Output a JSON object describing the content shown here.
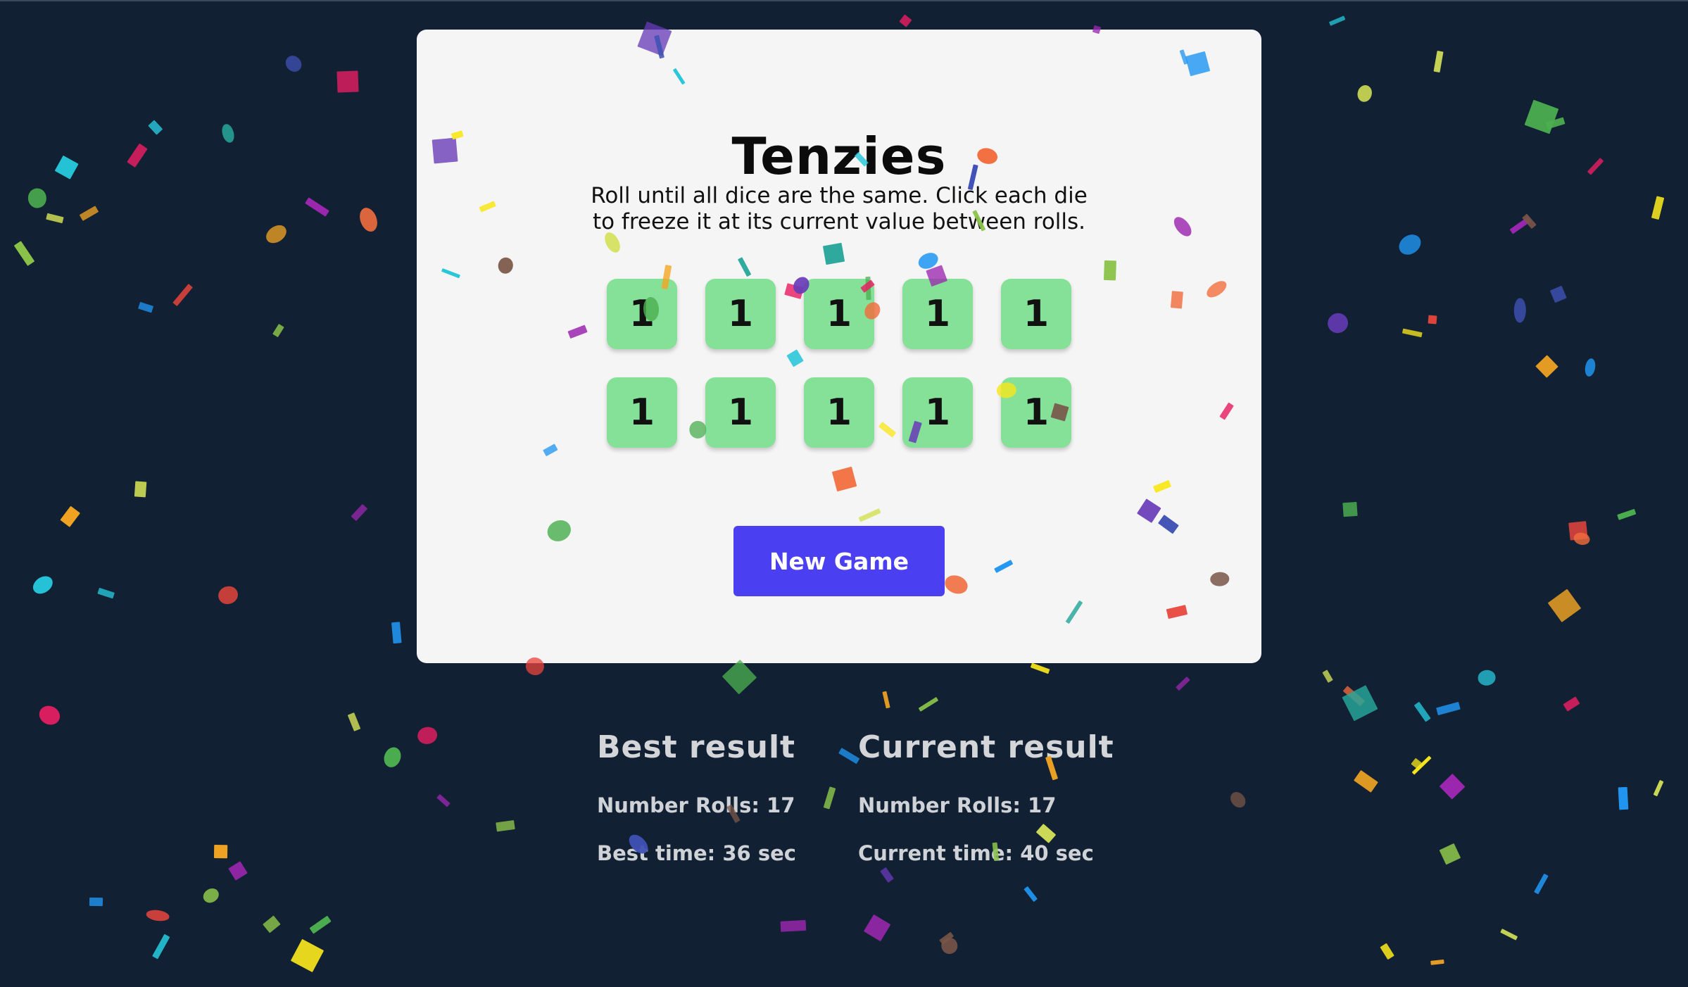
{
  "app": {
    "title": "Tenzies",
    "instructions": "Roll until all dice are the same. Click each die to freeze it at its current value between rolls."
  },
  "dice": [
    {
      "value": "1"
    },
    {
      "value": "1"
    },
    {
      "value": "1"
    },
    {
      "value": "1"
    },
    {
      "value": "1"
    },
    {
      "value": "1"
    },
    {
      "value": "1"
    },
    {
      "value": "1"
    },
    {
      "value": "1"
    },
    {
      "value": "1"
    }
  ],
  "controls": {
    "new_game_label": "New Game"
  },
  "best": {
    "heading": "Best result",
    "rolls": "Number Rolls: 17",
    "time": "Best time: 36 sec"
  },
  "current": {
    "heading": "Current result",
    "rolls": "Number Rolls: 17",
    "time": "Current time: 40 sec"
  },
  "colors": {
    "background": "#112032",
    "card": "#f5f5f5",
    "die": "#84e197",
    "button": "#4a40f2",
    "results_text": "#d3d5d8"
  },
  "confetti_colors": [
    "#e8453c",
    "#f26d3d",
    "#f5a623",
    "#f8e71c",
    "#d4e157",
    "#8bc34a",
    "#4caf50",
    "#26a69a",
    "#26c6da",
    "#2196f3",
    "#3f51b5",
    "#673ab7",
    "#9c27b0",
    "#e91e63",
    "#795548"
  ]
}
